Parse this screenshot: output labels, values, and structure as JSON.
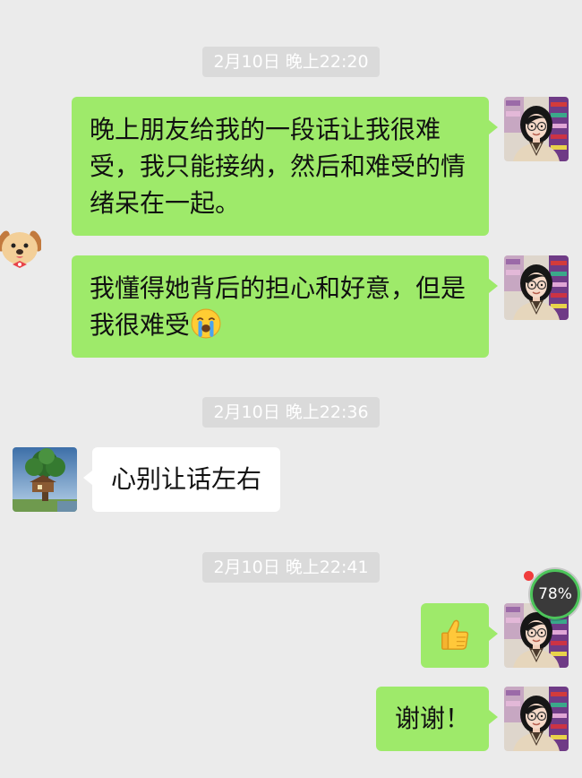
{
  "colors": {
    "page_background": "#ebebeb",
    "outgoing_bubble": "#9eea6a",
    "incoming_bubble": "#ffffff",
    "timestamp_pill": "#dadada",
    "timestamp_text": "#ffffff",
    "message_text": "#111111",
    "notification_dot": "#f03c3c",
    "widget_ring": "#4cc45a",
    "widget_fill": "#3a3a3a"
  },
  "chat": {
    "timestamp_1": "2月10日 晚上22:20",
    "message_1": {
      "text": "晚上朋友给我的一段话让我很难受，我只能接纳，然后和难受的情绪呆在一起。",
      "avatar": "portrait-photo-icon"
    },
    "message_2": {
      "text": "我懂得她背后的担心和好意，但是我很难受",
      "emoji": "loudly-crying-face-icon",
      "avatar": "portrait-photo-icon"
    },
    "timestamp_2": "2月10日 晚上22:36",
    "message_3": {
      "text": "心别让话左右",
      "avatar": "treehouse-photo-icon"
    },
    "timestamp_3": "2月10日 晚上22:41",
    "message_4": {
      "emoji": "thumbs-up-icon",
      "avatar": "portrait-photo-icon"
    },
    "message_5": {
      "text": "谢谢！",
      "avatar": "portrait-photo-icon"
    }
  },
  "overlays": {
    "floating_sticker": "dog-face-icon",
    "memory_widget": {
      "label": "78%",
      "dot_icon": "notification-dot-icon"
    }
  }
}
